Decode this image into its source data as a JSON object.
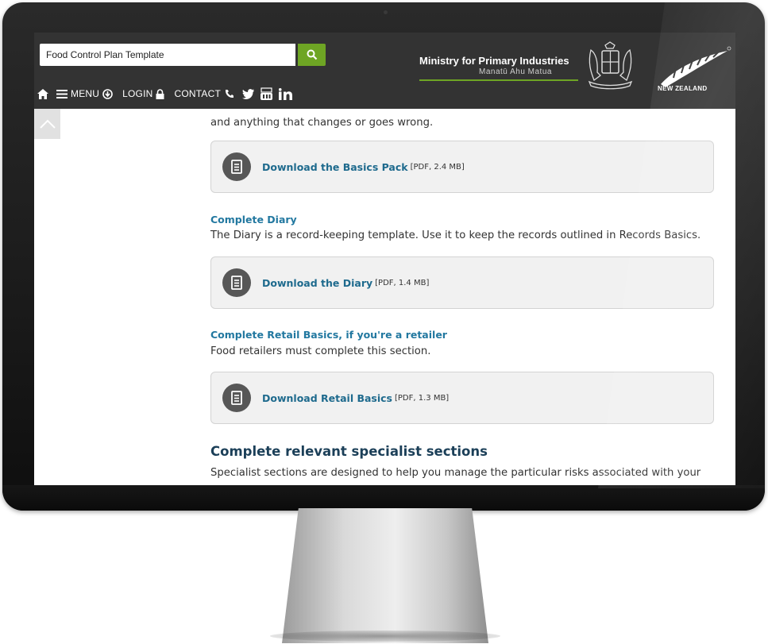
{
  "search": {
    "value": "Food Control Plan Template"
  },
  "nav": {
    "menu_label": "MENU",
    "login_label": "LOGIN",
    "contact_label": "CONTACT"
  },
  "brand": {
    "title": "Ministry for Primary Industries",
    "subtitle": "Manatū Ahu Matua",
    "nz_text": "NEW ZEALAND",
    "accent_color": "#6ea524",
    "header_color": "#333333"
  },
  "content": {
    "intro_text": "and anything that changes or goes wrong.",
    "download_basics": {
      "label": "Download the Basics Pack",
      "meta": "[PDF, 2.4 MB]"
    },
    "diary": {
      "heading": "Complete Diary",
      "text": "The Diary is a record-keeping template. Use it to keep the records outlined in Records Basics.",
      "download_label": "Download the Diary",
      "download_meta": "[PDF, 1.4 MB]"
    },
    "retail": {
      "heading": "Complete Retail Basics, if you're a retailer",
      "text": "Food retailers must complete this section.",
      "download_label": "Download Retail Basics",
      "download_meta": "[PDF, 1.3 MB]"
    },
    "specialist": {
      "heading": "Complete relevant specialist sections",
      "text": "Specialist sections are designed to help you manage the particular risks associated with your"
    }
  }
}
